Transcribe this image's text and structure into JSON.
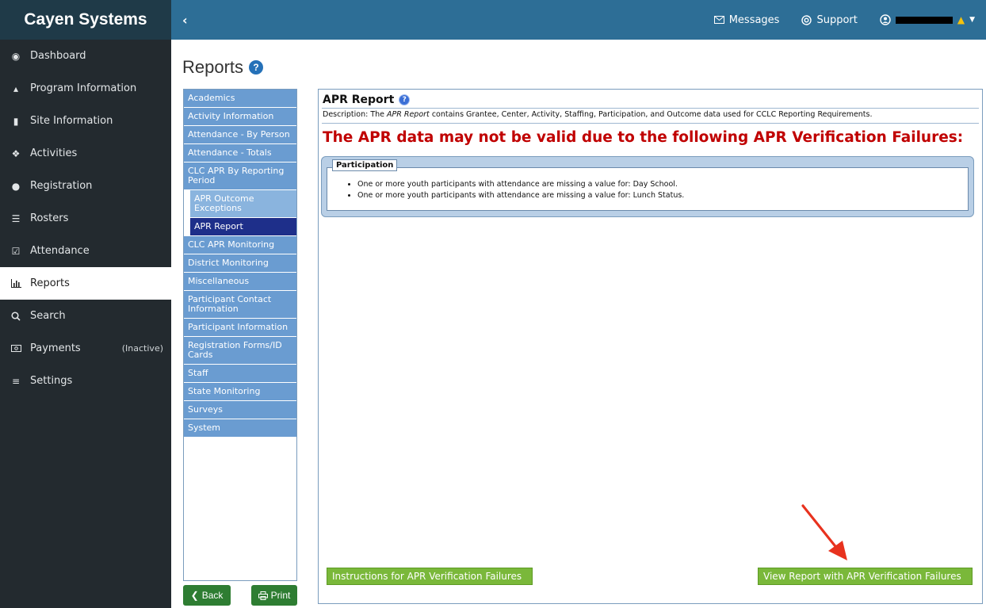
{
  "brand": {
    "name": "Cayen Systems"
  },
  "topnav": {
    "collapse_glyph": "‹",
    "messages": "Messages",
    "support": "Support"
  },
  "sidebar": {
    "items": [
      {
        "label": "Dashboard",
        "icon": "tachometer-icon"
      },
      {
        "label": "Program Information",
        "icon": "institution-icon"
      },
      {
        "label": "Site Information",
        "icon": "building-icon"
      },
      {
        "label": "Activities",
        "icon": "puzzle-icon"
      },
      {
        "label": "Registration",
        "icon": "users-icon"
      },
      {
        "label": "Rosters",
        "icon": "list-icon"
      },
      {
        "label": "Attendance",
        "icon": "calendar-check-icon"
      },
      {
        "label": "Reports",
        "icon": "bar-chart-icon",
        "active": true
      },
      {
        "label": "Search",
        "icon": "search-icon"
      },
      {
        "label": "Payments",
        "icon": "money-icon",
        "extra": "(Inactive)"
      },
      {
        "label": "Settings",
        "icon": "sliders-icon"
      }
    ]
  },
  "page": {
    "title": "Reports"
  },
  "report_menu": {
    "items": [
      {
        "label": "Academics"
      },
      {
        "label": "Activity Information"
      },
      {
        "label": "Attendance - By Person"
      },
      {
        "label": "Attendance - Totals"
      },
      {
        "label": "CLC APR By Reporting Period"
      },
      {
        "label": "APR Outcome Exceptions",
        "level": "sub"
      },
      {
        "label": "APR Report",
        "level": "selected"
      },
      {
        "label": "CLC APR Monitoring"
      },
      {
        "label": "District Monitoring"
      },
      {
        "label": "Miscellaneous"
      },
      {
        "label": "Participant Contact Information"
      },
      {
        "label": "Participant Information"
      },
      {
        "label": "Registration Forms/ID Cards"
      },
      {
        "label": "Staff"
      },
      {
        "label": "State Monitoring"
      },
      {
        "label": "Surveys"
      },
      {
        "label": "System"
      }
    ],
    "back_label": "Back",
    "print_label": "Print"
  },
  "report": {
    "title": "APR Report",
    "description_prefix": "Description: The ",
    "description_em": "APR Report",
    "description_suffix": " contains Grantee, Center, Activity, Staffing, Participation, and Outcome data used for CCLC Reporting Requirements.",
    "warning": "The APR data may not be valid due to the following APR Verification Failures:",
    "failures": {
      "legend": "Participation",
      "items": [
        "One or more youth participants with attendance are missing a value for: Day School.",
        "One or more youth participants with attendance are missing a value for: Lunch Status."
      ]
    },
    "instructions_button": "Instructions for APR Verification Failures",
    "view_button": "View Report with APR Verification Failures"
  },
  "colors": {
    "sidebar_bg": "#232a2f",
    "topbar_bg": "#2d6e96",
    "menu_item": "#6a9cd1",
    "menu_selected": "#1e2f8a",
    "warning_red": "#c00000",
    "action_green": "#7ab83a",
    "annotation_arrow": "#e8321e"
  }
}
